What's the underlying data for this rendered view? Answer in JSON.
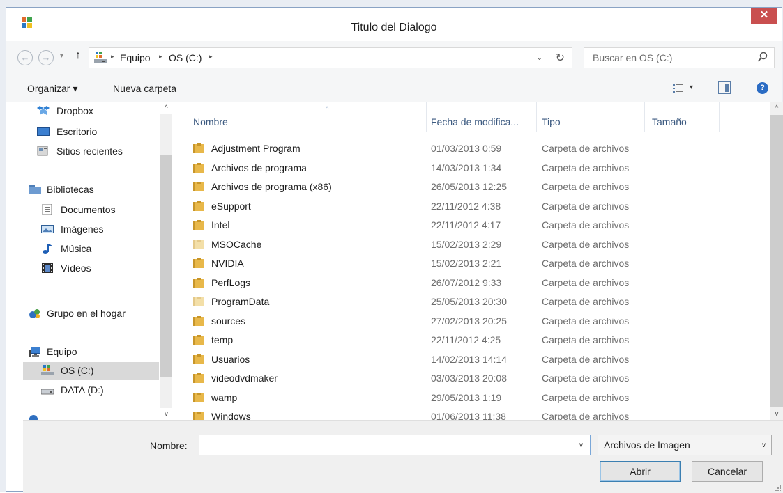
{
  "window": {
    "title": "Titulo del Dialogo",
    "close_glyph": "✕"
  },
  "nav": {
    "back_glyph": "←",
    "forward_glyph": "→",
    "recent_glyph": "▾",
    "up_glyph": "↑",
    "breadcrumb": [
      "Equipo",
      "OS (C:)"
    ],
    "separator_glyph": "▸",
    "history_glyph": "⌄",
    "refresh_glyph": "↻",
    "search_placeholder": "Buscar en OS (C:)",
    "search_icon": "magnifier-icon"
  },
  "toolbar": {
    "organize_label": "Organizar ▾",
    "new_folder_label": "Nueva carpeta",
    "view_icon": "view-options-icon",
    "view_drop_glyph": "▾",
    "preview_icon": "preview-pane-icon",
    "help_glyph": "?"
  },
  "sidebar": {
    "favorites": [
      {
        "label": "Dropbox",
        "icon": "dropbox-icon"
      },
      {
        "label": "Escritorio",
        "icon": "desktop-icon"
      },
      {
        "label": "Sitios recientes",
        "icon": "recent-places-icon"
      }
    ],
    "libraries": {
      "label": "Bibliotecas",
      "icon": "libraries-icon"
    },
    "library_items": [
      {
        "label": "Documentos",
        "icon": "documents-icon"
      },
      {
        "label": "Imágenes",
        "icon": "pictures-icon"
      },
      {
        "label": "Música",
        "icon": "music-icon"
      },
      {
        "label": "Vídeos",
        "icon": "videos-icon"
      }
    ],
    "homegroup": {
      "label": "Grupo en el hogar",
      "icon": "homegroup-icon"
    },
    "computer": {
      "label": "Equipo",
      "icon": "computer-icon"
    },
    "drives": [
      {
        "label": "OS (C:)",
        "icon": "system-drive-icon",
        "selected": true
      },
      {
        "label": "DATA (D:)",
        "icon": "data-drive-icon",
        "selected": false
      }
    ],
    "scroll_up_glyph": "^",
    "scroll_down_glyph": "v"
  },
  "list": {
    "columns": [
      "Nombre",
      "Fecha de modifica...",
      "Tipo",
      "Tamaño"
    ],
    "sort_glyph": "^",
    "rows": [
      {
        "name": "Adjustment Program",
        "date": "01/03/2013 0:59",
        "type": "Carpeta de archivos"
      },
      {
        "name": "Archivos de programa",
        "date": "14/03/2013 1:34",
        "type": "Carpeta de archivos"
      },
      {
        "name": "Archivos de programa (x86)",
        "date": "26/05/2013 12:25",
        "type": "Carpeta de archivos"
      },
      {
        "name": "eSupport",
        "date": "22/11/2012 4:38",
        "type": "Carpeta de archivos"
      },
      {
        "name": "Intel",
        "date": "22/11/2012 4:17",
        "type": "Carpeta de archivos"
      },
      {
        "name": "MSOCache",
        "date": "15/02/2013 2:29",
        "type": "Carpeta de archivos",
        "hidden": true
      },
      {
        "name": "NVIDIA",
        "date": "15/02/2013 2:21",
        "type": "Carpeta de archivos"
      },
      {
        "name": "PerfLogs",
        "date": "26/07/2012 9:33",
        "type": "Carpeta de archivos"
      },
      {
        "name": "ProgramData",
        "date": "25/05/2013 20:30",
        "type": "Carpeta de archivos",
        "hidden": true
      },
      {
        "name": "sources",
        "date": "27/02/2013 20:25",
        "type": "Carpeta de archivos"
      },
      {
        "name": "temp",
        "date": "22/11/2012 4:25",
        "type": "Carpeta de archivos"
      },
      {
        "name": "Usuarios",
        "date": "14/02/2013 14:14",
        "type": "Carpeta de archivos"
      },
      {
        "name": "videodvdmaker",
        "date": "03/03/2013 20:08",
        "type": "Carpeta de archivos"
      },
      {
        "name": "wamp",
        "date": "29/05/2013 1:19",
        "type": "Carpeta de archivos"
      },
      {
        "name": "Windows",
        "date": "01/06/2013 11:38",
        "type": "Carpeta de archivos"
      }
    ],
    "scroll_up_glyph": "^",
    "scroll_down_glyph": "v"
  },
  "footer": {
    "filename_label": "Nombre:",
    "filename_value": "",
    "filename_dropdown_glyph": "v",
    "filter_value": "Archivos de Imagen",
    "filter_dropdown_glyph": "v",
    "open_label": "Abrir",
    "cancel_label": "Cancelar"
  },
  "colors": {
    "close": "#c94f4f",
    "folder": "#e8b84a",
    "selected": "#d9d9d9",
    "header_text": "#3c5a80"
  }
}
